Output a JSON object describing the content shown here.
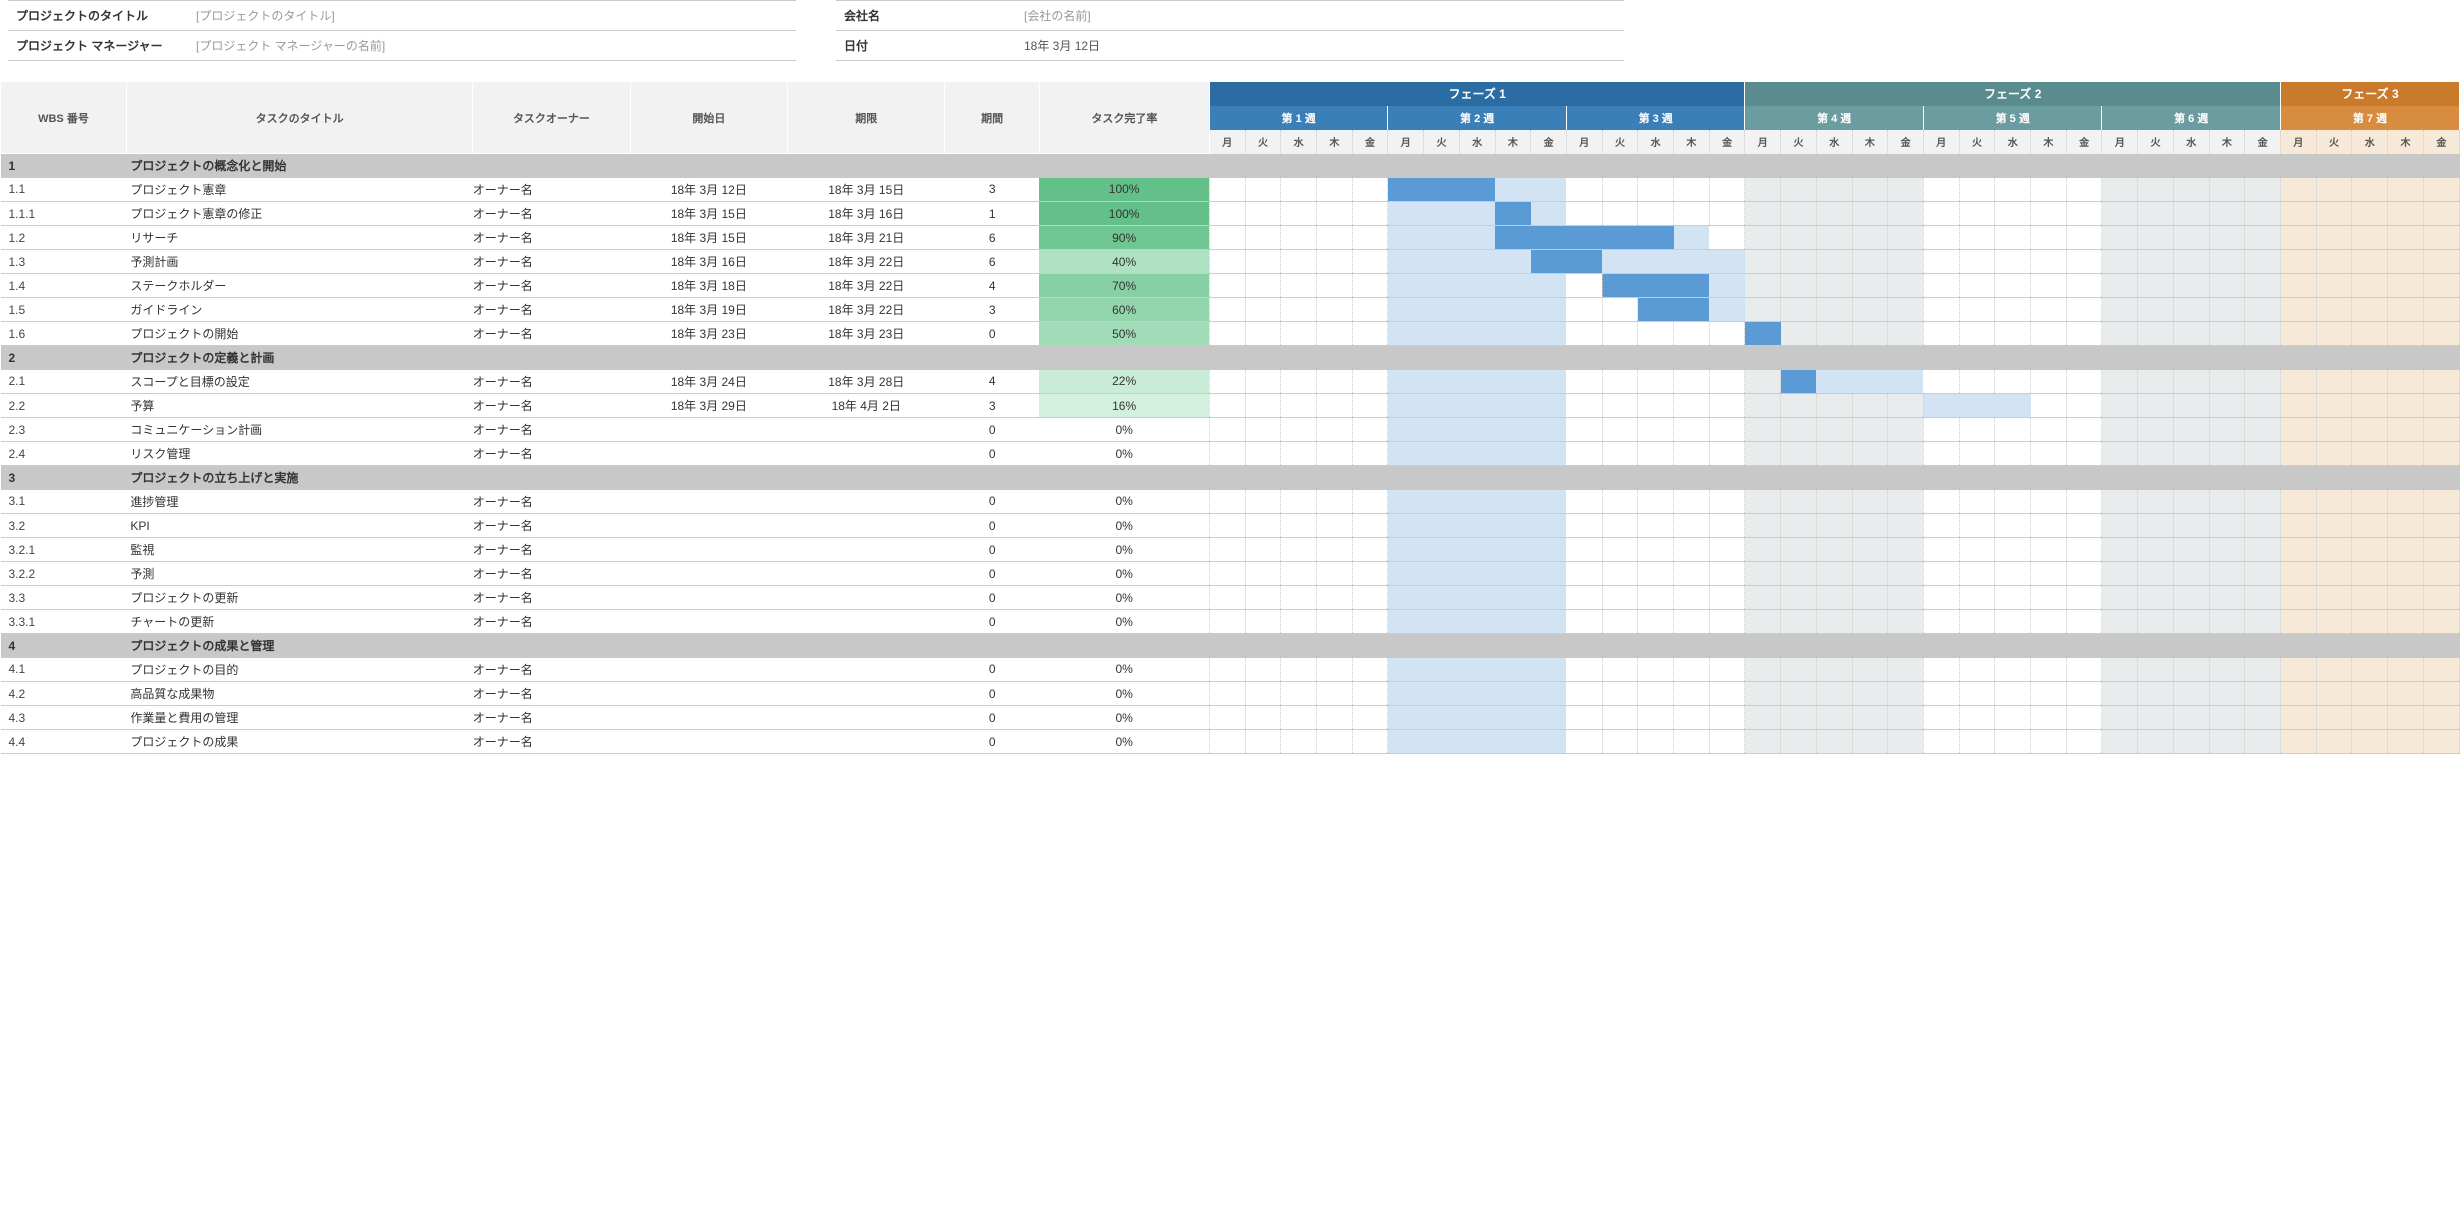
{
  "meta": {
    "left": {
      "title_label": "プロジェクトのタイトル",
      "title_value": "[プロジェクトのタイトル]",
      "manager_label": "プロジェクト マネージャー",
      "manager_value": "[プロジェクト マネージャーの名前]"
    },
    "right": {
      "company_label": "会社名",
      "company_value": "[会社の名前]",
      "date_label": "日付",
      "date_value": "18年 3月 12日"
    }
  },
  "headers": {
    "wbs": "WBS 番号",
    "title": "タスクのタイトル",
    "owner": "タスクオーナー",
    "start": "開始日",
    "due": "期限",
    "duration": "期間",
    "pct": "タスク完了率"
  },
  "phases": [
    {
      "label": "フェーズ 1",
      "class": "ph1",
      "weeks": 3
    },
    {
      "label": "フェーズ 2",
      "class": "ph2",
      "weeks": 3
    },
    {
      "label": "フェーズ 3",
      "class": "ph3",
      "weeks": 1,
      "partial": true
    }
  ],
  "weeks": [
    {
      "label": "第 1 週",
      "class": "wk-ph1",
      "shade": ""
    },
    {
      "label": "第 2 週",
      "class": "wk-ph1",
      "shade": "bar-light"
    },
    {
      "label": "第 3 週",
      "class": "wk-ph1",
      "shade": ""
    },
    {
      "label": "第 4 週",
      "class": "wk-ph2",
      "shade": "shade"
    },
    {
      "label": "第 5 週",
      "class": "wk-ph2",
      "shade": ""
    },
    {
      "label": "第 6 週",
      "class": "wk-ph2",
      "shade": "shade"
    },
    {
      "label": "第 7 週",
      "class": "wk-ph3",
      "shade": "shade7"
    }
  ],
  "days": [
    "月",
    "火",
    "水",
    "木",
    "金"
  ],
  "pct_colors": {
    "100": "#63c088",
    "90": "#6fc692",
    "70": "#86d0a4",
    "60": "#93d6ae",
    "50": "#a1dbb7",
    "40": "#aee1c1",
    "22": "#c8ecd5",
    "16": "#d2f0dd"
  },
  "sections": [
    {
      "wbs": "1",
      "title": "プロジェクトの概念化と開始",
      "rows": [
        {
          "wbs": "1.1",
          "title": "プロジェクト憲章",
          "owner": "オーナー名",
          "start": "18年 3月 12日",
          "due": "18年 3月 15日",
          "dur": "3",
          "pct": "100%",
          "pctColor": "#63c088",
          "barStart": 5,
          "barDarkLen": 3,
          "barLightLen": 0
        },
        {
          "wbs": "1.1.1",
          "title": "プロジェクト憲章の修正",
          "owner": "オーナー名",
          "start": "18年 3月 15日",
          "due": "18年 3月 16日",
          "dur": "1",
          "pct": "100%",
          "pctColor": "#63c088",
          "barStart": 8,
          "barDarkLen": 1,
          "barLightLen": 0
        },
        {
          "wbs": "1.2",
          "title": "リサーチ",
          "owner": "オーナー名",
          "start": "18年 3月 15日",
          "due": "18年 3月 21日",
          "dur": "6",
          "pct": "90%",
          "pctColor": "#6fc692",
          "barStart": 8,
          "barDarkLen": 5,
          "barLightLen": 1
        },
        {
          "wbs": "1.3",
          "title": "予測計画",
          "owner": "オーナー名",
          "start": "18年 3月 16日",
          "due": "18年 3月 22日",
          "dur": "6",
          "pct": "40%",
          "pctColor": "#aee1c1",
          "barStart": 9,
          "barDarkLen": 2,
          "barLightLen": 4
        },
        {
          "wbs": "1.4",
          "title": "ステークホルダー",
          "owner": "オーナー名",
          "start": "18年 3月 18日",
          "due": "18年 3月 22日",
          "dur": "4",
          "pct": "70%",
          "pctColor": "#86d0a4",
          "barStart": 11,
          "barDarkLen": 3,
          "barLightLen": 1
        },
        {
          "wbs": "1.5",
          "title": "ガイドライン",
          "owner": "オーナー名",
          "start": "18年 3月 19日",
          "due": "18年 3月 22日",
          "dur": "3",
          "pct": "60%",
          "pctColor": "#93d6ae",
          "barStart": 12,
          "barDarkLen": 2,
          "barLightLen": 1
        },
        {
          "wbs": "1.6",
          "title": "プロジェクトの開始",
          "owner": "オーナー名",
          "start": "18年 3月 23日",
          "due": "18年 3月 23日",
          "dur": "0",
          "pct": "50%",
          "pctColor": "#a1dbb7",
          "barStart": 15,
          "barDarkLen": 1,
          "barLightLen": 0
        }
      ]
    },
    {
      "wbs": "2",
      "title": "プロジェクトの定義と計画",
      "rows": [
        {
          "wbs": "2.1",
          "title": "スコープと目標の設定",
          "owner": "オーナー名",
          "start": "18年 3月 24日",
          "due": "18年 3月 28日",
          "dur": "4",
          "pct": "22%",
          "pctColor": "#c8ecd5",
          "barStart": 16,
          "barDarkLen": 1,
          "barLightLen": 3
        },
        {
          "wbs": "2.2",
          "title": "予算",
          "owner": "オーナー名",
          "start": "18年 3月 29日",
          "due": "18年 4月 2日",
          "dur": "3",
          "pct": "16%",
          "pctColor": "#d2f0dd",
          "barStart": 20,
          "barDarkLen": 0,
          "barLightLen": 3
        },
        {
          "wbs": "2.3",
          "title": "コミュニケーション計画",
          "owner": "オーナー名",
          "start": "",
          "due": "",
          "dur": "0",
          "pct": "0%"
        },
        {
          "wbs": "2.4",
          "title": "リスク管理",
          "owner": "オーナー名",
          "start": "",
          "due": "",
          "dur": "0",
          "pct": "0%"
        }
      ]
    },
    {
      "wbs": "3",
      "title": "プロジェクトの立ち上げと実施",
      "rows": [
        {
          "wbs": "3.1",
          "title": "進捗管理",
          "owner": "オーナー名",
          "start": "",
          "due": "",
          "dur": "0",
          "pct": "0%"
        },
        {
          "wbs": "3.2",
          "title": "KPI",
          "owner": "オーナー名",
          "start": "",
          "due": "",
          "dur": "0",
          "pct": "0%"
        },
        {
          "wbs": "3.2.1",
          "title": "監視",
          "owner": "オーナー名",
          "start": "",
          "due": "",
          "dur": "0",
          "pct": "0%"
        },
        {
          "wbs": "3.2.2",
          "title": "予測",
          "owner": "オーナー名",
          "start": "",
          "due": "",
          "dur": "0",
          "pct": "0%"
        },
        {
          "wbs": "3.3",
          "title": "プロジェクトの更新",
          "owner": "オーナー名",
          "start": "",
          "due": "",
          "dur": "0",
          "pct": "0%"
        },
        {
          "wbs": "3.3.1",
          "title": "チャートの更新",
          "owner": "オーナー名",
          "start": "",
          "due": "",
          "dur": "0",
          "pct": "0%"
        }
      ]
    },
    {
      "wbs": "4",
      "title": "プロジェクトの成果と管理",
      "rows": [
        {
          "wbs": "4.1",
          "title": "プロジェクトの目的",
          "owner": "オーナー名",
          "start": "",
          "due": "",
          "dur": "0",
          "pct": "0%"
        },
        {
          "wbs": "4.2",
          "title": "高品質な成果物",
          "owner": "オーナー名",
          "start": "",
          "due": "",
          "dur": "0",
          "pct": "0%"
        },
        {
          "wbs": "4.3",
          "title": "作業量と費用の管理",
          "owner": "オーナー名",
          "start": "",
          "due": "",
          "dur": "0",
          "pct": "0%"
        },
        {
          "wbs": "4.4",
          "title": "プロジェクトの成果",
          "owner": "オーナー名",
          "start": "",
          "due": "",
          "dur": "0",
          "pct": "0%"
        }
      ]
    }
  ]
}
